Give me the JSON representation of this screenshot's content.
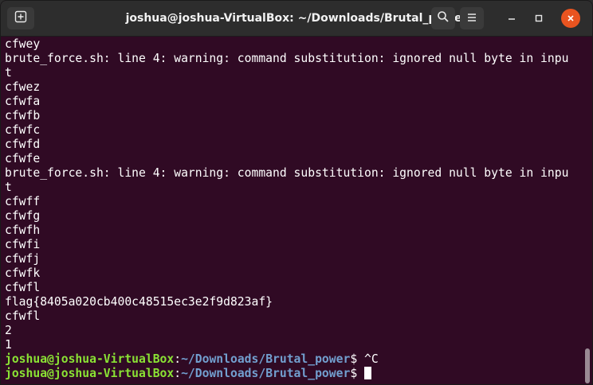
{
  "window": {
    "title": "joshua@joshua-VirtualBox: ~/Downloads/Brutal_power"
  },
  "icons": {
    "new_tab": "new-tab-icon",
    "search": "search-icon",
    "menu": "hamburger-menu-icon",
    "minimize": "minimize-icon",
    "maximize": "maximize-icon",
    "close": "close-icon"
  },
  "colors": {
    "terminal_bg": "#300a24",
    "titlebar_bg": "#2d2d2d",
    "prompt_user": "#8ae234",
    "prompt_path": "#729fcf",
    "close_button": "#e95420"
  },
  "terminal": {
    "lines": [
      "cfwey",
      "brute_force.sh: line 4: warning: command substitution: ignored null byte in inpu",
      "t",
      "cfwez",
      "cfwfa",
      "cfwfb",
      "cfwfc",
      "cfwfd",
      "cfwfe",
      "brute_force.sh: line 4: warning: command substitution: ignored null byte in inpu",
      "t",
      "cfwff",
      "cfwfg",
      "cfwfh",
      "cfwfi",
      "cfwfj",
      "cfwfk",
      "cfwfl",
      "flag{8405a020cb400c48515ec3e2f9d823af}",
      "cfwfl",
      "2",
      "1"
    ],
    "prompts": [
      {
        "user": "joshua@joshua-VirtualBox",
        "sep": ":",
        "path": "~/Downloads/Brutal_power",
        "symbol": "$ ",
        "command": "^C"
      },
      {
        "user": "joshua@joshua-VirtualBox",
        "sep": ":",
        "path": "~/Downloads/Brutal_power",
        "symbol": "$ ",
        "command": ""
      }
    ]
  }
}
